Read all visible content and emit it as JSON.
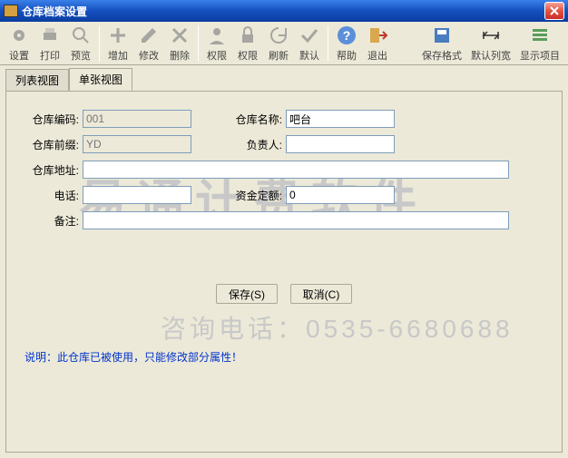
{
  "window": {
    "title": "仓库档案设置"
  },
  "toolbar": {
    "settings": "设置",
    "print": "打印",
    "preview": "预览",
    "add": "增加",
    "modify": "修改",
    "delete": "删除",
    "perm1": "权限",
    "perm2": "权限",
    "refresh": "刷新",
    "default": "默认",
    "help": "帮助",
    "exit": "退出",
    "saveFormat": "保存格式",
    "defaultWidth": "默认列宽",
    "showItems": "显示项目"
  },
  "tabs": {
    "list": "列表视图",
    "single": "单张视图"
  },
  "form": {
    "codeLabel": "仓库编码:",
    "codeValue": "001",
    "nameLabel": "仓库名称:",
    "nameValue": "吧台",
    "prefixLabel": "仓库前缀:",
    "prefixValue": "YD",
    "personLabel": "负责人:",
    "personValue": "",
    "addressLabel": "仓库地址:",
    "addressValue": "",
    "phoneLabel": "电话:",
    "phoneValue": "",
    "quotaLabel": "资金定额:",
    "quotaValue": "0",
    "remarkLabel": "备注:",
    "remarkValue": ""
  },
  "buttons": {
    "save": "保存(S)",
    "cancel": "取消(C)"
  },
  "note": "说明：此仓库已被使用，只能修改部分属性！",
  "watermark": {
    "main": "易通计费软件",
    "sub": "咨询电话：0535-6680688"
  }
}
